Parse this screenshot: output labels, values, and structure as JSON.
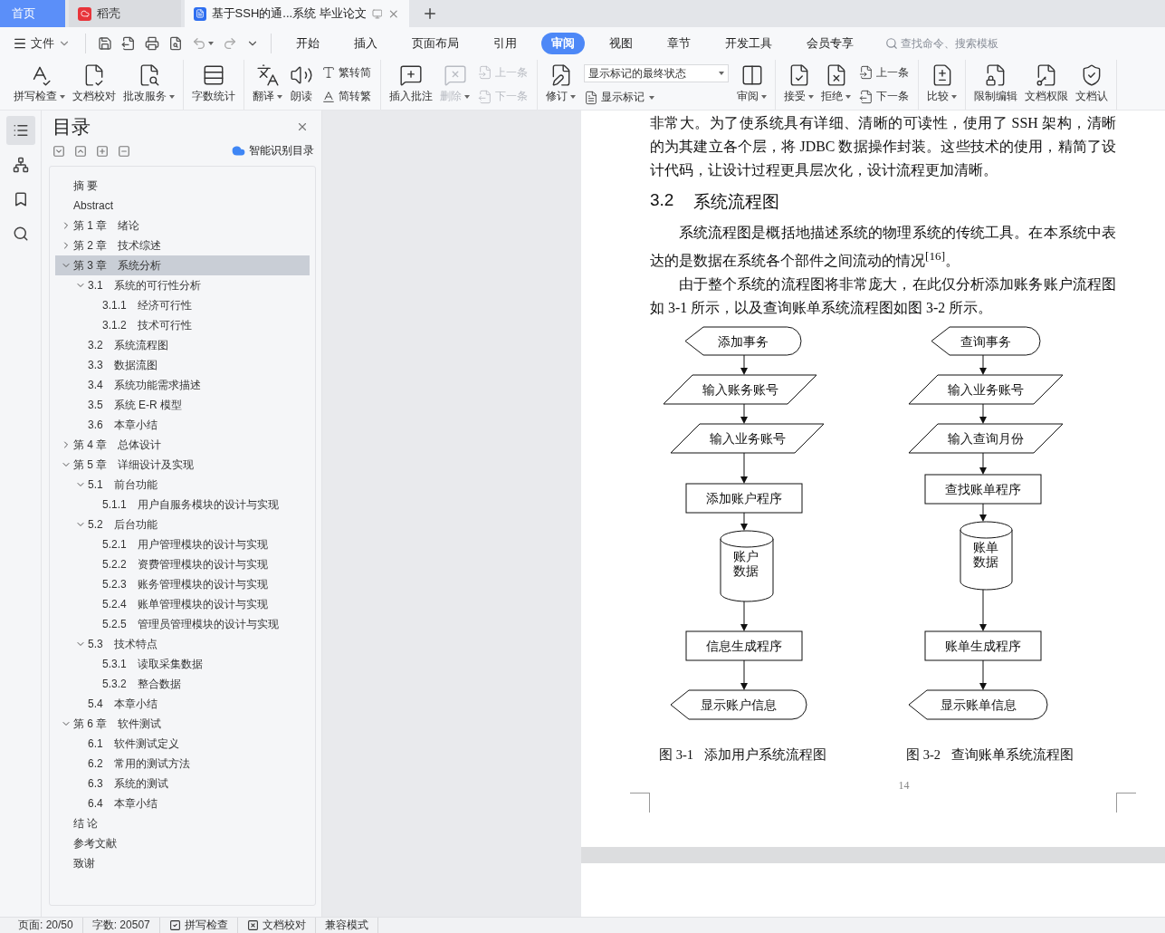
{
  "tabs": [
    {
      "label": "首页",
      "kind": "home",
      "selected": false
    },
    {
      "label": "稻壳",
      "kind": "app",
      "selected": false
    },
    {
      "label": "基于SSH的通...系统 毕业论文",
      "kind": "doc",
      "selected": true
    }
  ],
  "menu": {
    "file": "文件",
    "items": [
      {
        "label": "开始",
        "selected": false
      },
      {
        "label": "插入",
        "selected": false
      },
      {
        "label": "页面布局",
        "selected": false
      },
      {
        "label": "引用",
        "selected": false
      },
      {
        "label": "审阅",
        "selected": true
      },
      {
        "label": "视图",
        "selected": false
      },
      {
        "label": "章节",
        "selected": false
      },
      {
        "label": "开发工具",
        "selected": false
      },
      {
        "label": "会员专享",
        "selected": false
      }
    ],
    "search": {
      "placeholder": "查找命令、搜索模板"
    }
  },
  "ribbon": [
    [
      {
        "kind": "large",
        "label": "拼写检查",
        "dropdown": true,
        "disabled": false
      },
      {
        "kind": "large",
        "label": "文档校对",
        "dropdown": false,
        "disabled": false
      },
      {
        "kind": "large",
        "label": "批改服务",
        "dropdown": true,
        "disabled": false
      }
    ],
    [
      {
        "kind": "large",
        "label": "字数统计",
        "dropdown": false,
        "disabled": false
      }
    ],
    [
      {
        "kind": "large",
        "label": "翻译",
        "dropdown": true,
        "disabled": false
      },
      {
        "kind": "large",
        "label": "朗读",
        "dropdown": false,
        "disabled": false
      },
      {
        "kind": "stack",
        "items": [
          {
            "label": "繁转简",
            "dropdown": false,
            "disabled": false
          },
          {
            "label": "简转繁",
            "dropdown": false,
            "disabled": false
          }
        ]
      }
    ],
    [
      {
        "kind": "large",
        "label": "插入批注",
        "dropdown": false,
        "disabled": false
      },
      {
        "kind": "large",
        "label": "删除",
        "dropdown": true,
        "disabled": true
      },
      {
        "kind": "stack",
        "items": [
          {
            "label": "上一条",
            "dropdown": false,
            "disabled": true
          },
          {
            "label": "下一条",
            "dropdown": false,
            "disabled": true
          }
        ]
      }
    ],
    [
      {
        "kind": "large",
        "label": "修订",
        "dropdown": true,
        "disabled": false
      },
      {
        "kind": "select_stack",
        "value": "显示标记的最终状态",
        "items": [
          {
            "label": "显示标记",
            "dropdown": true,
            "disabled": false
          }
        ]
      },
      {
        "kind": "large",
        "label": "审阅",
        "dropdown": true,
        "disabled": false
      }
    ],
    [
      {
        "kind": "large",
        "label": "接受",
        "dropdown": true,
        "disabled": false
      },
      {
        "kind": "large",
        "label": "拒绝",
        "dropdown": true,
        "disabled": false
      },
      {
        "kind": "stack",
        "items": [
          {
            "label": "上一条",
            "dropdown": false,
            "disabled": false
          },
          {
            "label": "下一条",
            "dropdown": false,
            "disabled": false
          }
        ]
      }
    ],
    [
      {
        "kind": "large",
        "label": "比较",
        "dropdown": true,
        "disabled": false
      }
    ],
    [
      {
        "kind": "large",
        "label": "限制编辑",
        "dropdown": false,
        "disabled": false
      },
      {
        "kind": "large",
        "label": "文档权限",
        "dropdown": false,
        "disabled": false
      },
      {
        "kind": "large",
        "label": "文档认",
        "dropdown": false,
        "disabled": false
      }
    ]
  ],
  "nav": {
    "title": "目录",
    "smart_button": "智能识别目录",
    "tree": [
      {
        "title": "摘 要",
        "selected": false
      },
      {
        "title": "Abstract",
        "selected": false
      },
      {
        "number": "第 1 章",
        "title": "绪论",
        "expanded": false,
        "selected": false
      },
      {
        "number": "第 2 章",
        "title": "技术综述",
        "expanded": false,
        "selected": false
      },
      {
        "number": "第 3 章",
        "title": "系统分析",
        "expanded": true,
        "selected": true,
        "children": [
          {
            "number": "3.1",
            "title": "系统的可行性分析",
            "expanded": true,
            "selected": false,
            "children": [
              {
                "number": "3.1.1",
                "title": "经济可行性",
                "selected": false
              },
              {
                "number": "3.1.2",
                "title": "技术可行性",
                "selected": false
              }
            ]
          },
          {
            "number": "3.2",
            "title": "系统流程图",
            "selected": false
          },
          {
            "number": "3.3",
            "title": "数据流图",
            "selected": false
          },
          {
            "number": "3.4",
            "title": "系统功能需求描述",
            "selected": false
          },
          {
            "number": "3.5",
            "title": "系统 E-R 模型",
            "selected": false
          },
          {
            "number": "3.6",
            "title": "本章小结",
            "selected": false
          }
        ]
      },
      {
        "number": "第 4 章",
        "title": "总体设计",
        "expanded": false,
        "selected": false
      },
      {
        "number": "第 5 章",
        "title": "详细设计及实现",
        "expanded": true,
        "selected": false,
        "children": [
          {
            "number": "5.1",
            "title": "前台功能",
            "expanded": true,
            "selected": false,
            "children": [
              {
                "number": "5.1.1",
                "title": "用户自服务模块的设计与实现",
                "selected": false
              }
            ]
          },
          {
            "number": "5.2",
            "title": "后台功能",
            "expanded": true,
            "selected": false,
            "children": [
              {
                "number": "5.2.1",
                "title": "用户管理模块的设计与实现",
                "selected": false
              },
              {
                "number": "5.2.2",
                "title": "资费管理模块的设计与实现",
                "selected": false
              },
              {
                "number": "5.2.3",
                "title": "账务管理模块的设计与实现",
                "selected": false
              },
              {
                "number": "5.2.4",
                "title": "账单管理模块的设计与实现",
                "selected": false
              },
              {
                "number": "5.2.5",
                "title": "管理员管理模块的设计与实现",
                "selected": false
              }
            ]
          },
          {
            "number": "5.3",
            "title": "技术特点",
            "expanded": true,
            "selected": false,
            "children": [
              {
                "number": "5.3.1",
                "title": "读取采集数据",
                "selected": false
              },
              {
                "number": "5.3.2",
                "title": "整合数据",
                "selected": false
              }
            ]
          },
          {
            "number": "5.4",
            "title": "本章小结",
            "selected": false
          }
        ]
      },
      {
        "number": "第 6 章",
        "title": "软件测试",
        "expanded": true,
        "selected": false,
        "children": [
          {
            "number": "6.1",
            "title": "软件测试定义",
            "selected": false
          },
          {
            "number": "6.2",
            "title": "常用的测试方法",
            "selected": false
          },
          {
            "number": "6.3",
            "title": "系统的测试",
            "selected": false
          },
          {
            "number": "6.4",
            "title": "本章小结",
            "selected": false
          }
        ]
      },
      {
        "title": "结 论",
        "selected": false
      },
      {
        "title": "参考文献",
        "selected": false
      },
      {
        "title": "致谢",
        "selected": false
      }
    ]
  },
  "document": {
    "blocks": [
      {
        "kind": "paragraph",
        "indent": false,
        "text": "非常大。为了使系统具有详细、清晰的可读性，使用了 SSH 架构，清晰的为其建立各个层，将 JDBC 数据操作封装。这些技术的使用，精简了设计代码，让设计过程更具层次化，设计流程更加清晰。"
      },
      {
        "kind": "heading",
        "number": "3.2",
        "title": "系统流程图"
      },
      {
        "kind": "paragraph",
        "indent": true,
        "text": "系统流程图是概括地描述系统的物理系统的传统工具。在本系统中表达的是数据在系统各个部件之间流动的情况$^{[16]}$。"
      },
      {
        "kind": "paragraph",
        "indent": true,
        "text": "由于整个系统的流程图将非常庞大，在此仅分析添加账务账户流程图如 3-1 所示，以及查询账单系统流程图如图 3-2 所示。"
      }
    ],
    "figures": [
      {
        "caption_number": "图 3-1",
        "caption": "添加用户系统流程图",
        "nodes": [
          {
            "kind": "terminal",
            "text": "添加事务"
          },
          {
            "kind": "io",
            "text": "输入账务账号"
          },
          {
            "kind": "io",
            "text": "输入业务账号"
          },
          {
            "kind": "process",
            "text": "添加账户程序"
          },
          {
            "kind": "database",
            "text": "账户数据"
          },
          {
            "kind": "process",
            "text": "信息生成程序"
          },
          {
            "kind": "terminal",
            "text": "显示账户信息"
          }
        ]
      },
      {
        "caption_number": "图 3-2",
        "caption": "查询账单系统流程图",
        "nodes": [
          {
            "kind": "terminal",
            "text": "查询事务"
          },
          {
            "kind": "io",
            "text": "输入业务账号"
          },
          {
            "kind": "io",
            "text": "输入查询月份"
          },
          {
            "kind": "process",
            "text": "查找账单程序"
          },
          {
            "kind": "database",
            "text": "账单数据"
          },
          {
            "kind": "process",
            "text": "账单生成程序"
          },
          {
            "kind": "terminal",
            "text": "显示账单信息"
          }
        ]
      }
    ],
    "page_number": "14"
  },
  "status_bar": [
    {
      "kind": "text",
      "label": "页面: 20/50"
    },
    {
      "kind": "text",
      "label": "字数: 20507"
    },
    {
      "kind": "check",
      "label": "拼写检查",
      "checked": true
    },
    {
      "kind": "check",
      "label": "文档校对",
      "checked": false
    },
    {
      "kind": "text",
      "label": "兼容模式"
    }
  ]
}
